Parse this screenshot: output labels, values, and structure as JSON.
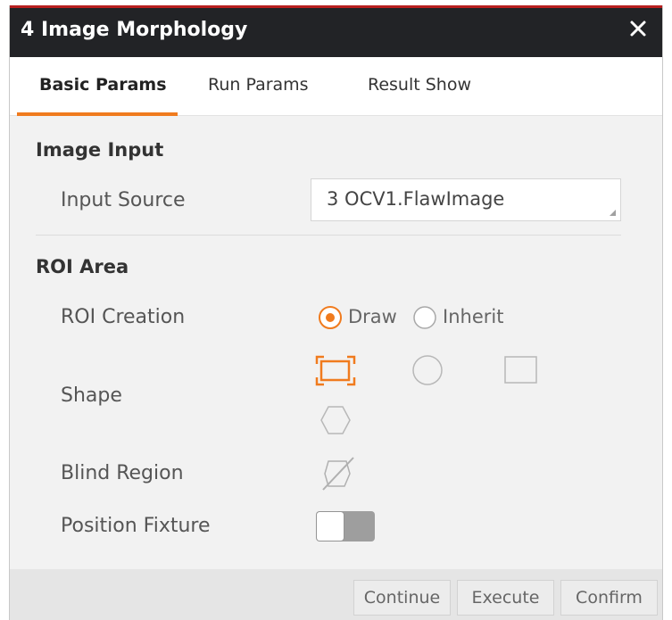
{
  "window": {
    "title": "4 Image Morphology",
    "close_icon": "close-icon"
  },
  "tabs": [
    {
      "label": "Basic Params",
      "active": true
    },
    {
      "label": "Run Params",
      "active": false
    },
    {
      "label": "Result Show",
      "active": false
    }
  ],
  "image_input": {
    "section_title": "Image Input",
    "input_source_label": "Input Source",
    "input_source_value": "3 OCV1.FlawImage"
  },
  "roi_area": {
    "section_title": "ROI Area",
    "roi_creation_label": "ROI Creation",
    "roi_creation_options": [
      {
        "label": "Draw",
        "selected": true
      },
      {
        "label": "Inherit",
        "selected": false
      }
    ],
    "shape_label": "Shape",
    "shape_options": [
      {
        "icon": "rectangle-select-icon",
        "selected": true
      },
      {
        "icon": "circle-icon",
        "selected": false
      },
      {
        "icon": "square-icon",
        "selected": false
      },
      {
        "icon": "hexagon-icon",
        "selected": false
      }
    ],
    "blind_region_label": "Blind Region",
    "blind_region_icon": "blind-region-icon",
    "position_fixture_label": "Position Fixture",
    "position_fixture_on": false
  },
  "footer": {
    "continue_label": "Continue",
    "execute_label": "Execute",
    "confirm_label": "Confirm"
  },
  "colors": {
    "accent": "#f07b1e",
    "titlebar": "#222326",
    "titlebar_top_border": "#b81f1f"
  }
}
